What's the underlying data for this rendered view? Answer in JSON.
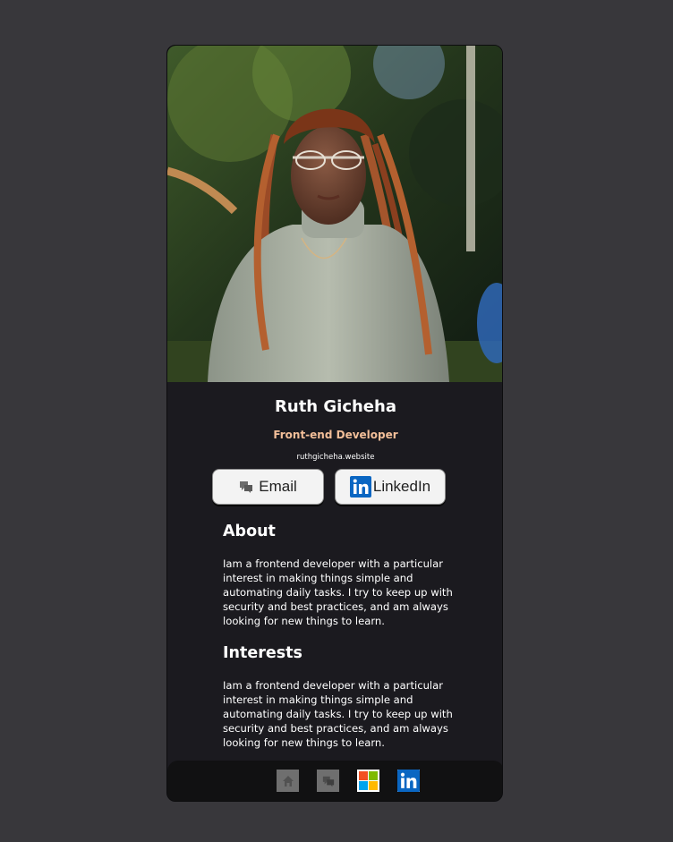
{
  "profile": {
    "name": "Ruth Gicheha",
    "role": "Front-end Developer",
    "website": "ruthgicheha.website"
  },
  "buttons": {
    "email_label": "Email",
    "linkedin_label": "LinkedIn"
  },
  "about": {
    "heading": "About",
    "text": "Iam a frontend developer with a particular interest in making things simple and automating daily tasks. I try to keep up with security and best practices, and am always looking for new things to learn."
  },
  "interests": {
    "heading": "Interests",
    "text": "Iam a frontend developer with a particular interest in making things simple and automating daily tasks. I try to keep up with security and best practices, and am always looking for new things to learn."
  },
  "footer": {
    "icons": [
      "home-icon",
      "chat-icon",
      "microsoft-icon",
      "linkedin-icon"
    ]
  },
  "colors": {
    "page_bg": "#38373b",
    "card_bg": "#1b1a1f",
    "accent": "#f3bf99",
    "button_bg": "#f3f3f3",
    "linkedin_blue": "#0a66c2",
    "footer_bg": "#111112"
  }
}
